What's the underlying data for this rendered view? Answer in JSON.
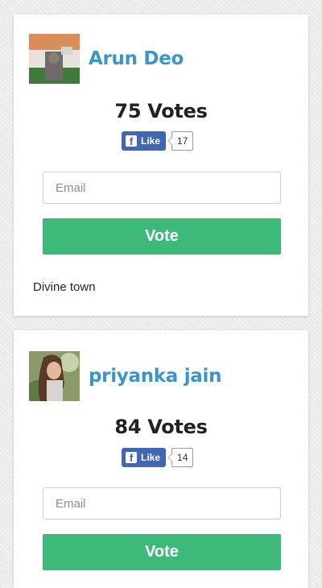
{
  "entries": [
    {
      "name": "Arun Deo",
      "votes": "75 Votes",
      "like_label": "Like",
      "like_count": "17",
      "email_placeholder": "Email",
      "vote_label": "Vote",
      "description": "Divine town"
    },
    {
      "name": "priyanka jain",
      "votes": "84 Votes",
      "like_label": "Like",
      "like_count": "14",
      "email_placeholder": "Email",
      "vote_label": "Vote"
    }
  ],
  "colors": {
    "name_link": "#3a95c9",
    "vote_button": "#3dba79",
    "facebook": "#4267b2"
  },
  "icons": {
    "like": "facebook-f-icon"
  }
}
